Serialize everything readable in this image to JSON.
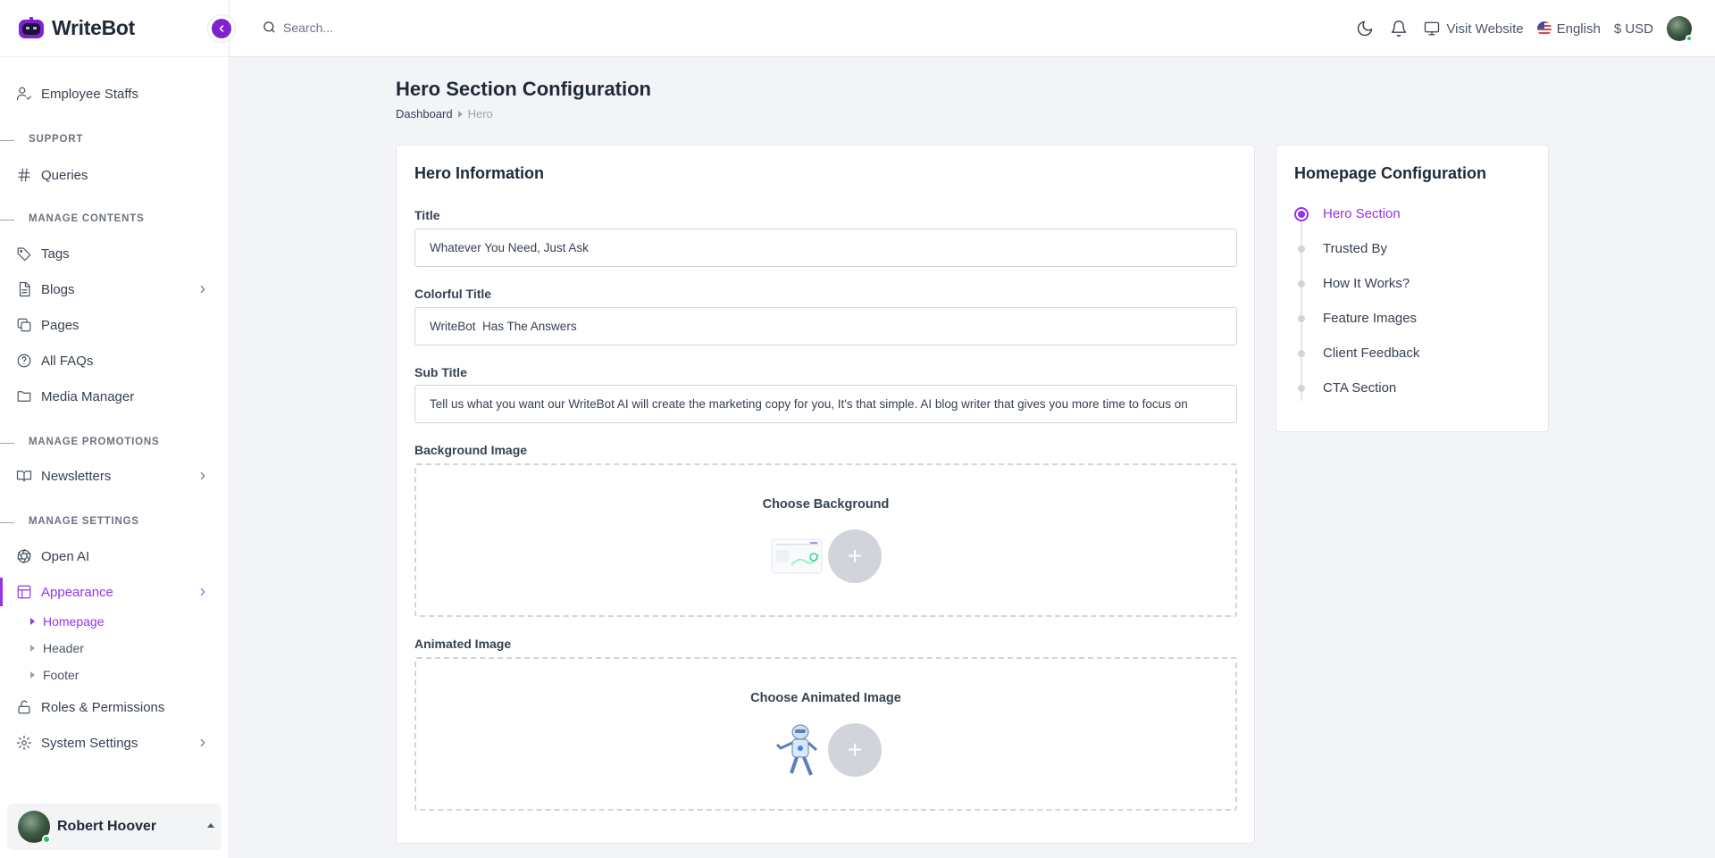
{
  "brand": {
    "name": "WriteBot"
  },
  "search": {
    "placeholder": "Search..."
  },
  "topbar": {
    "visit_website": "Visit Website",
    "language": "English",
    "currency": "$ USD"
  },
  "sidebar": {
    "employee_staffs": "Employee Staffs",
    "support_heading": "SUPPORT",
    "queries": "Queries",
    "manage_contents_heading": "MANAGE CONTENTS",
    "tags": "Tags",
    "blogs": "Blogs",
    "pages": "Pages",
    "all_faqs": "All FAQs",
    "media_manager": "Media Manager",
    "manage_promotions_heading": "MANAGE PROMOTIONS",
    "newsletters": "Newsletters",
    "manage_settings_heading": "MANAGE SETTINGS",
    "open_ai": "Open AI",
    "appearance": "Appearance",
    "appearance_sub": [
      "Homepage",
      "Header",
      "Footer"
    ],
    "roles_permissions": "Roles & Permissions",
    "system_settings": "System Settings",
    "user_name": "Robert Hoover"
  },
  "page": {
    "title": "Hero Section Configuration",
    "breadcrumb_home": "Dashboard",
    "breadcrumb_current": "Hero"
  },
  "hero": {
    "card_title": "Hero Information",
    "title_label": "Title",
    "title_value": "Whatever You Need, Just Ask",
    "colorful_title_label": "Colorful Title",
    "colorful_title_value": "WriteBot  Has The Answers",
    "subtitle_label": "Sub Title",
    "subtitle_value": "Tell us what you want our WriteBot AI will create the marketing copy for you, It's that simple. AI blog writer that gives you more time to focus on",
    "bg_image_label": "Background Image",
    "bg_choose": "Choose Background",
    "animated_image_label": "Animated Image",
    "animated_choose": "Choose Animated Image",
    "add_symbol": "+"
  },
  "homepage_config": {
    "title": "Homepage Configuration",
    "steps": [
      "Hero Section",
      "Trusted By",
      "How It Works?",
      "Feature Images",
      "Client Feedback",
      "CTA Section"
    ],
    "active_index": 0
  },
  "colors": {
    "accent": "#9333ea",
    "accent_dark": "#7e22ce"
  }
}
